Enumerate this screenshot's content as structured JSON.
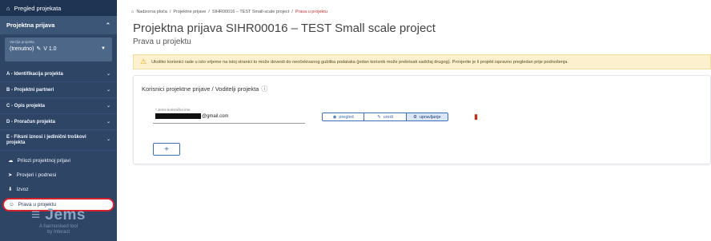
{
  "sidebar": {
    "overview_label": "Pregled projekata",
    "section_label": "Projektna prijava",
    "version": {
      "label": "Verzija projekta",
      "value": "(trenutno)",
      "number": "V 1.0"
    },
    "items": [
      {
        "label": "A - Identifikacija projekta"
      },
      {
        "label": "B - Projektni partneri"
      },
      {
        "label": "C - Opis projekta"
      },
      {
        "label": "D - Proračun projekta"
      },
      {
        "label": "E - Fiksni iznosi i jedinični troškovi projekta"
      }
    ],
    "links": [
      {
        "label": "Prilozi projektnoj prijavi"
      },
      {
        "label": "Provjeri i podnesi"
      },
      {
        "label": "Izvoz"
      },
      {
        "label": "Prava u projektu"
      }
    ],
    "logo": {
      "brand": "Jems",
      "tag1": "A harmonised tool",
      "tag2": "by Interact"
    }
  },
  "breadcrumb": {
    "items": [
      "Nadzorna ploča",
      "Projektne prijave",
      "SIHR00016 – TEST Small-scale project"
    ],
    "current": "Prava u projektu",
    "separator": "/"
  },
  "page": {
    "title": "Projektna prijava SIHR00016 – TEST Small scale project",
    "subtitle": "Prava u projektu"
  },
  "alert": {
    "text": "Ukoliko korisnici rade u isto vrijeme na istoj stranici to može dovesti do neočekivanog gubitka podataka (jedan korisnik može prebrisati sadržaj drugog). Provjerite je li projekt ispravno pregledan prije podnošenja."
  },
  "card": {
    "title": "Korisnici projektne prijave / Voditelji projekta",
    "field_label": "* Jems korisničko ime",
    "field_value_suffix": "@gmail.com",
    "toggle": [
      {
        "label": "pregled",
        "icon": "eye-icon",
        "selected": false
      },
      {
        "label": "uredi",
        "icon": "pencil-icon",
        "selected": false
      },
      {
        "label": "upravljanje",
        "icon": "gear-icon",
        "selected": true
      }
    ],
    "add_label": "+"
  },
  "colors": {
    "sidebar_bg": "#2e4566",
    "accent": "#3b6cb8",
    "alert_bg": "#fdf0cf",
    "breadcrumb_current": "#c52e2e",
    "delete": "#c2301c"
  }
}
